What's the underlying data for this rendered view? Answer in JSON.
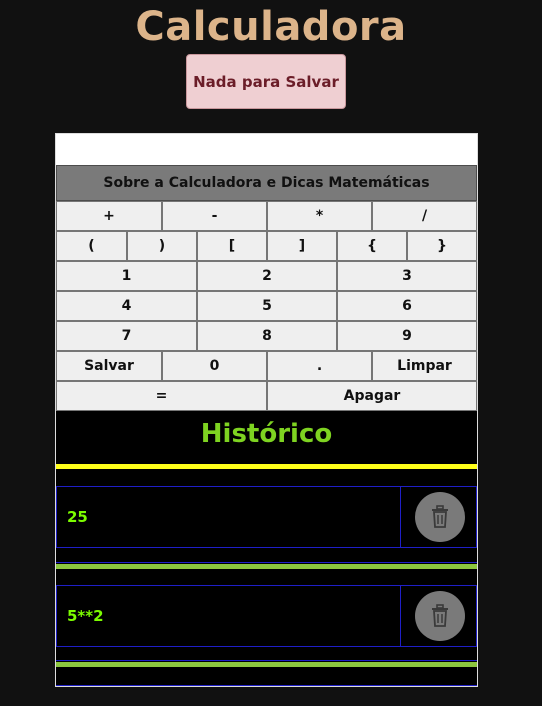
{
  "header": {
    "title": "Calculadora",
    "save_status": "Nada para Salvar"
  },
  "calculator": {
    "display_value": "",
    "about_label": "Sobre a Calculadora e Dicas Matemáticas",
    "operators": [
      "+",
      "-",
      "*",
      "/"
    ],
    "brackets": [
      "(",
      ")",
      "[",
      "]",
      "{",
      "}"
    ],
    "digits": [
      "1",
      "2",
      "3",
      "4",
      "5",
      "6",
      "7",
      "8",
      "9"
    ],
    "bottom_row": [
      "Salvar",
      "0",
      ".",
      "Limpar"
    ],
    "equals_label": "=",
    "delete_label": "Apagar"
  },
  "history": {
    "title": "Histórico",
    "items": [
      {
        "value": "25",
        "delete_icon": "trash-icon"
      },
      {
        "value": "5**2",
        "delete_icon": "trash-icon"
      }
    ]
  },
  "colors": {
    "background": "#111111",
    "title": "#dcb48a",
    "save_bg": "#efcfd2",
    "history_title": "#7ed321",
    "accent_yellow": "#ffff1a",
    "accent_green": "#8cc63f",
    "item_border": "#1f1fc8",
    "item_text": "#7cfc00"
  }
}
